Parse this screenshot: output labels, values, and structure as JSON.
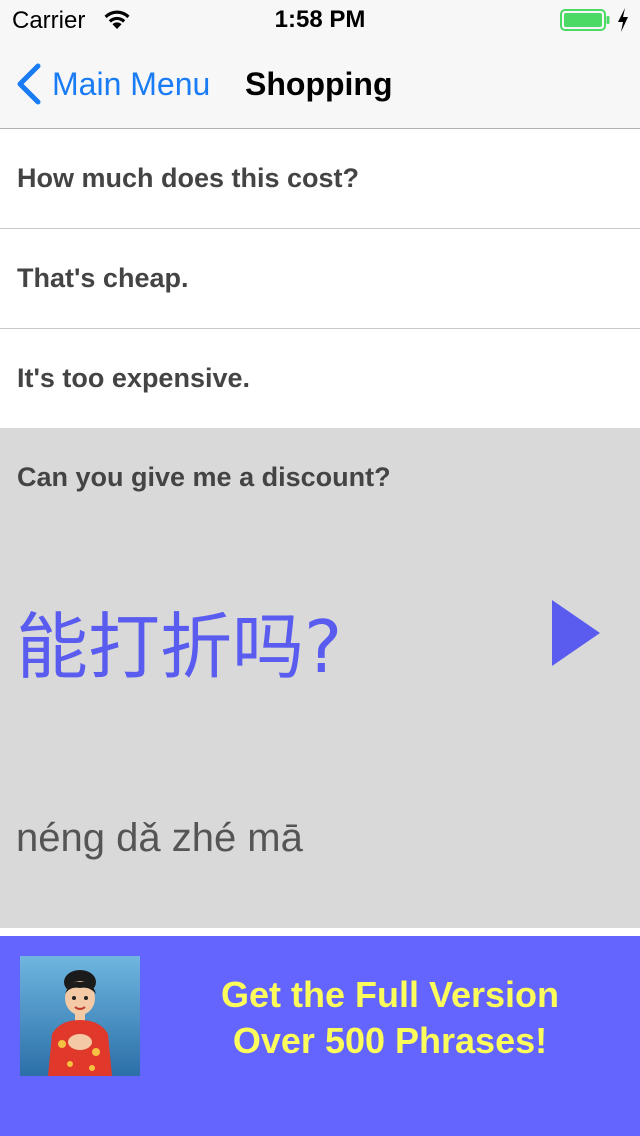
{
  "status_bar": {
    "carrier": "Carrier",
    "time": "1:58 PM"
  },
  "nav": {
    "back_label": "Main Menu",
    "title": "Shopping"
  },
  "phrases": [
    {
      "english": "How much does this cost?"
    },
    {
      "english": "That's cheap."
    },
    {
      "english": "It's too expensive."
    }
  ],
  "selected_phrase": {
    "english": "Can you give me a discount?",
    "chinese": "能打折吗?",
    "pinyin": "néng dǎ zhé mā"
  },
  "promo": {
    "line1": "Get the Full Version",
    "line2": "Over 500 Phrases!"
  },
  "colors": {
    "accent": "#1a7cf5",
    "chinese_text": "#5a5cf0",
    "banner_bg": "#6464ff",
    "banner_text": "#fcfc5a",
    "battery": "#4cd964"
  },
  "icons": [
    "wifi-icon",
    "battery-icon",
    "charging-icon",
    "back-chevron-icon",
    "play-icon"
  ]
}
